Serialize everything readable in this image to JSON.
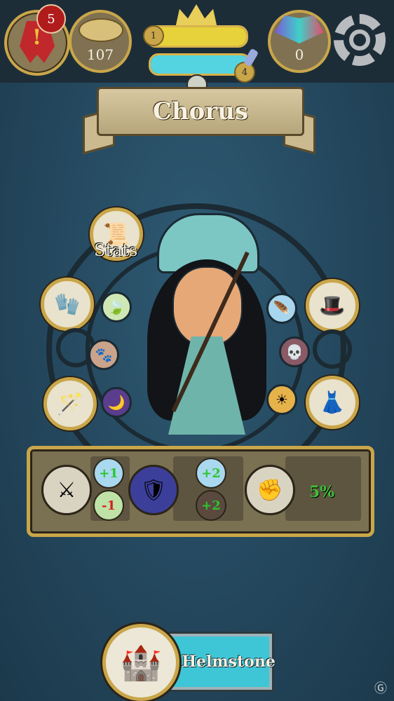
{
  "hud": {
    "quest_count": "5",
    "coins": "107",
    "level": "1",
    "potion_count": "4",
    "gems": "0"
  },
  "character": {
    "name": "Chorus"
  },
  "wheel": {
    "stats_label": "Stats"
  },
  "bonuses": {
    "weapon_mod_1": "+1",
    "weapon_mod_2": "-1",
    "armor_mod_1": "+2",
    "armor_mod_2": "+2",
    "crit_percent": "5%"
  },
  "town": {
    "name": "Helmstone"
  },
  "colors": {
    "xp_bar": "#e8d23c",
    "mana_bar": "#54d4e0",
    "gold_trim": "#c9a64a"
  }
}
